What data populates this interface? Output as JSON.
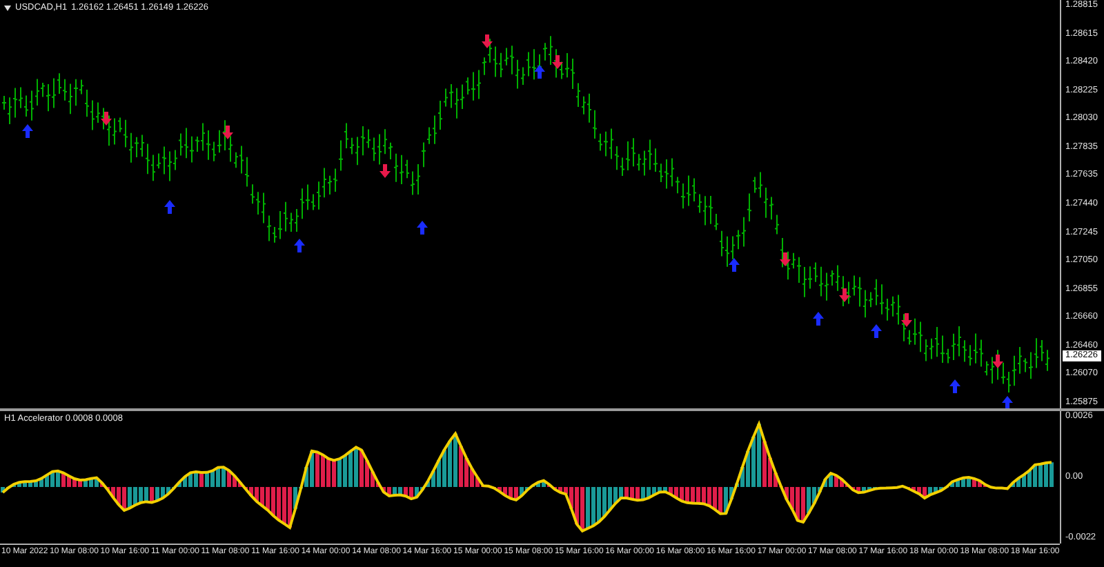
{
  "chart_header": {
    "symbol": "USDCAD,H1",
    "quote": "1.26162 1.26451 1.26149 1.26226"
  },
  "price_axis": {
    "labels": [
      "1.28815",
      "1.28615",
      "1.28420",
      "1.28225",
      "1.28030",
      "1.27835",
      "1.27635",
      "1.27440",
      "1.27245",
      "1.27050",
      "1.26855",
      "1.26660",
      "1.26460",
      "1.26070",
      "1.25875"
    ],
    "current_price": "1.26226"
  },
  "indicator": {
    "label": "H1 Accelerator 0.0008 0.0008",
    "axis_labels": [
      "0.0026",
      "0.00",
      "-0.0022"
    ]
  },
  "time_axis": {
    "labels": [
      "10 Mar 2022",
      "10 Mar 08:00",
      "10 Mar 16:00",
      "11 Mar 00:00",
      "11 Mar 08:00",
      "11 Mar 16:00",
      "14 Mar 00:00",
      "14 Mar 08:00",
      "14 Mar 16:00",
      "15 Mar 00:00",
      "15 Mar 08:00",
      "15 Mar 16:00",
      "16 Mar 00:00",
      "16 Mar 08:00",
      "16 Mar 16:00",
      "17 Mar 00:00",
      "17 Mar 08:00",
      "17 Mar 16:00",
      "18 Mar 00:00",
      "18 Mar 08:00",
      "18 Mar 16:00"
    ]
  }
}
